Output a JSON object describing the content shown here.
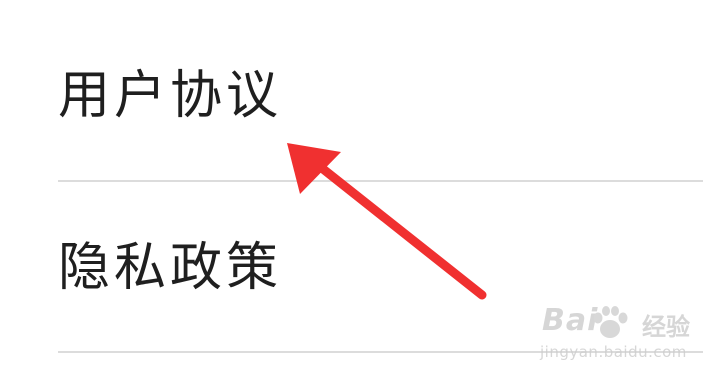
{
  "menu": {
    "items": [
      {
        "label": "用户协议"
      },
      {
        "label": "隐私政策"
      }
    ]
  },
  "annotation": {
    "arrow_color": "#f03030",
    "icon": "arrow-icon"
  },
  "watermark": {
    "brand": "Bai",
    "brand_suffix": "经验",
    "url": "jingyan.baidu.com",
    "icon": "paw-icon"
  },
  "colors": {
    "text": "#1f1f1f",
    "divider": "#dcdcdc",
    "background": "#ffffff"
  }
}
